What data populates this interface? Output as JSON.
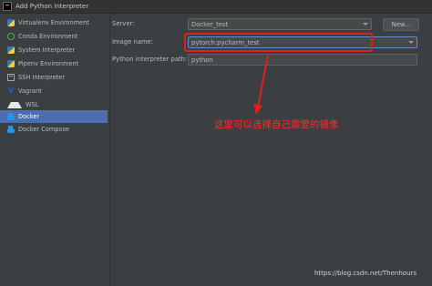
{
  "window": {
    "title": "Add Python Interpreter"
  },
  "sidebar": {
    "items": [
      {
        "label": "Virtualenv Environment",
        "icon": "python-icon",
        "selected": false
      },
      {
        "label": "Conda Environment",
        "icon": "conda-icon",
        "selected": false
      },
      {
        "label": "System Interpreter",
        "icon": "python-icon",
        "selected": false
      },
      {
        "label": "Pipenv Environment",
        "icon": "python-icon",
        "selected": false
      },
      {
        "label": "SSH Interpreter",
        "icon": "ssh-icon",
        "selected": false
      },
      {
        "label": "Vagrant",
        "icon": "vagrant-icon",
        "selected": false
      },
      {
        "label": "WSL",
        "icon": "wsl-icon",
        "selected": false
      },
      {
        "label": "Docker",
        "icon": "docker-icon",
        "selected": true
      },
      {
        "label": "Docker Compose",
        "icon": "docker-icon",
        "selected": false
      }
    ]
  },
  "form": {
    "server_label": "Server:",
    "server_value": "Docker_test",
    "new_button": "New...",
    "image_label": "Image name:",
    "image_value": "pytorch:pycharm_test",
    "path_label": "Python interpreter path:",
    "path_value": "python"
  },
  "annotation": {
    "text": "这里可以选择自己需要的镜像",
    "color": "#ff2a2a"
  },
  "watermark": {
    "text": "https://blog.csdn.net/Thenhours"
  },
  "colors": {
    "background": "#3c3f41",
    "selection": "#4b6eaf",
    "highlight": "#e0201f"
  }
}
